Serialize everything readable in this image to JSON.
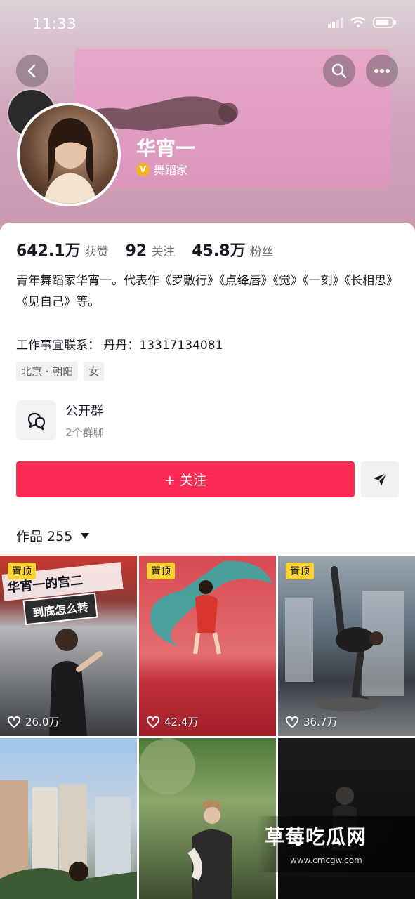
{
  "status_bar": {
    "time": "11:33"
  },
  "profile": {
    "name": "华宵一",
    "verified_label": "舞蹈家",
    "verified_badge": "V",
    "stats": [
      {
        "value": "642.1万",
        "label": "获赞"
      },
      {
        "value": "92",
        "label": "关注"
      },
      {
        "value": "45.8万",
        "label": "粉丝"
      }
    ],
    "bio": "青年舞蹈家华宵一。代表作《罗敷行》《点绛唇》《觉》《一刻》《长相思》《见自己》等。",
    "contact": "工作事宜联系： 丹丹：13317134081",
    "tags": [
      "北京 · 朝阳",
      "女"
    ]
  },
  "group": {
    "title": "公开群",
    "subtitle": "2个群聊"
  },
  "actions": {
    "follow_label": "+ 关注"
  },
  "works": {
    "label": "作品 255"
  },
  "tiles": [
    {
      "pinned": true,
      "pin_label": "置顶",
      "likes": "26.0万",
      "overlay_title": "华宵一的宫二",
      "overlay_sub": "到底怎么转"
    },
    {
      "pinned": true,
      "pin_label": "置顶",
      "likes": "42.4万"
    },
    {
      "pinned": true,
      "pin_label": "置顶",
      "likes": "36.7万"
    },
    {
      "pinned": false
    },
    {
      "pinned": false
    },
    {
      "pinned": false
    }
  ],
  "watermark": {
    "title": "草莓吃瓜网",
    "url": "www.cmcgw.com"
  },
  "colors": {
    "accent": "#fe2c55",
    "pin": "#fcd22e",
    "verify": "#f6b31b"
  },
  "icons": [
    "back-icon",
    "search-icon",
    "more-icon",
    "group-chat-icon",
    "share-icon",
    "heart-icon"
  ]
}
